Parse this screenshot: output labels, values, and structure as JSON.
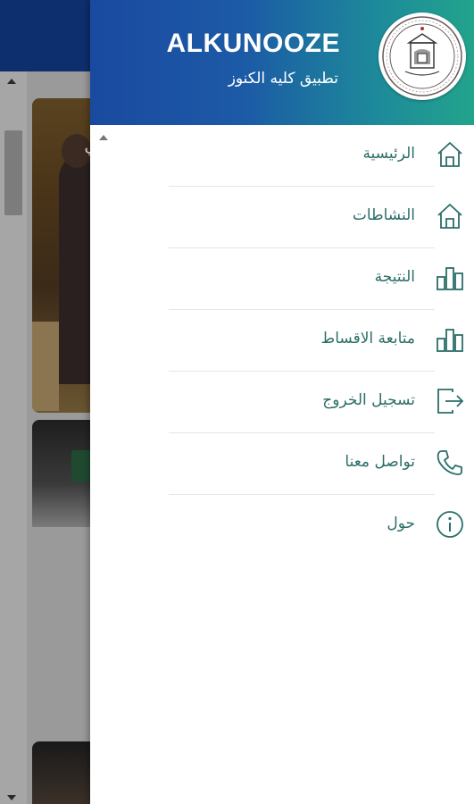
{
  "drawer": {
    "app_title": "ALKUNOOZE",
    "app_subtitle": "تطبيق كليه الكنوز",
    "logo": {
      "icon": "college-seal-logo"
    },
    "menu": [
      {
        "label": "الرئيسية",
        "icon": "home-icon"
      },
      {
        "label": "النشاطات",
        "icon": "home-icon"
      },
      {
        "label": "النتيجة",
        "icon": "bar-chart-icon"
      },
      {
        "label": "متابعة الاقساط",
        "icon": "bar-chart-icon"
      },
      {
        "label": "تسجيل الخروج",
        "icon": "logout-icon"
      },
      {
        "label": "تواصل معنا",
        "icon": "phone-icon"
      },
      {
        "label": "حول",
        "icon": "info-icon"
      }
    ]
  },
  "background": {
    "card1_text": "ي"
  },
  "colors": {
    "header_gradient_start": "#1a4aa0",
    "header_gradient_end": "#22a48c",
    "menu_text": "#2b6e68",
    "background_topbar": "#0d2f6e"
  }
}
